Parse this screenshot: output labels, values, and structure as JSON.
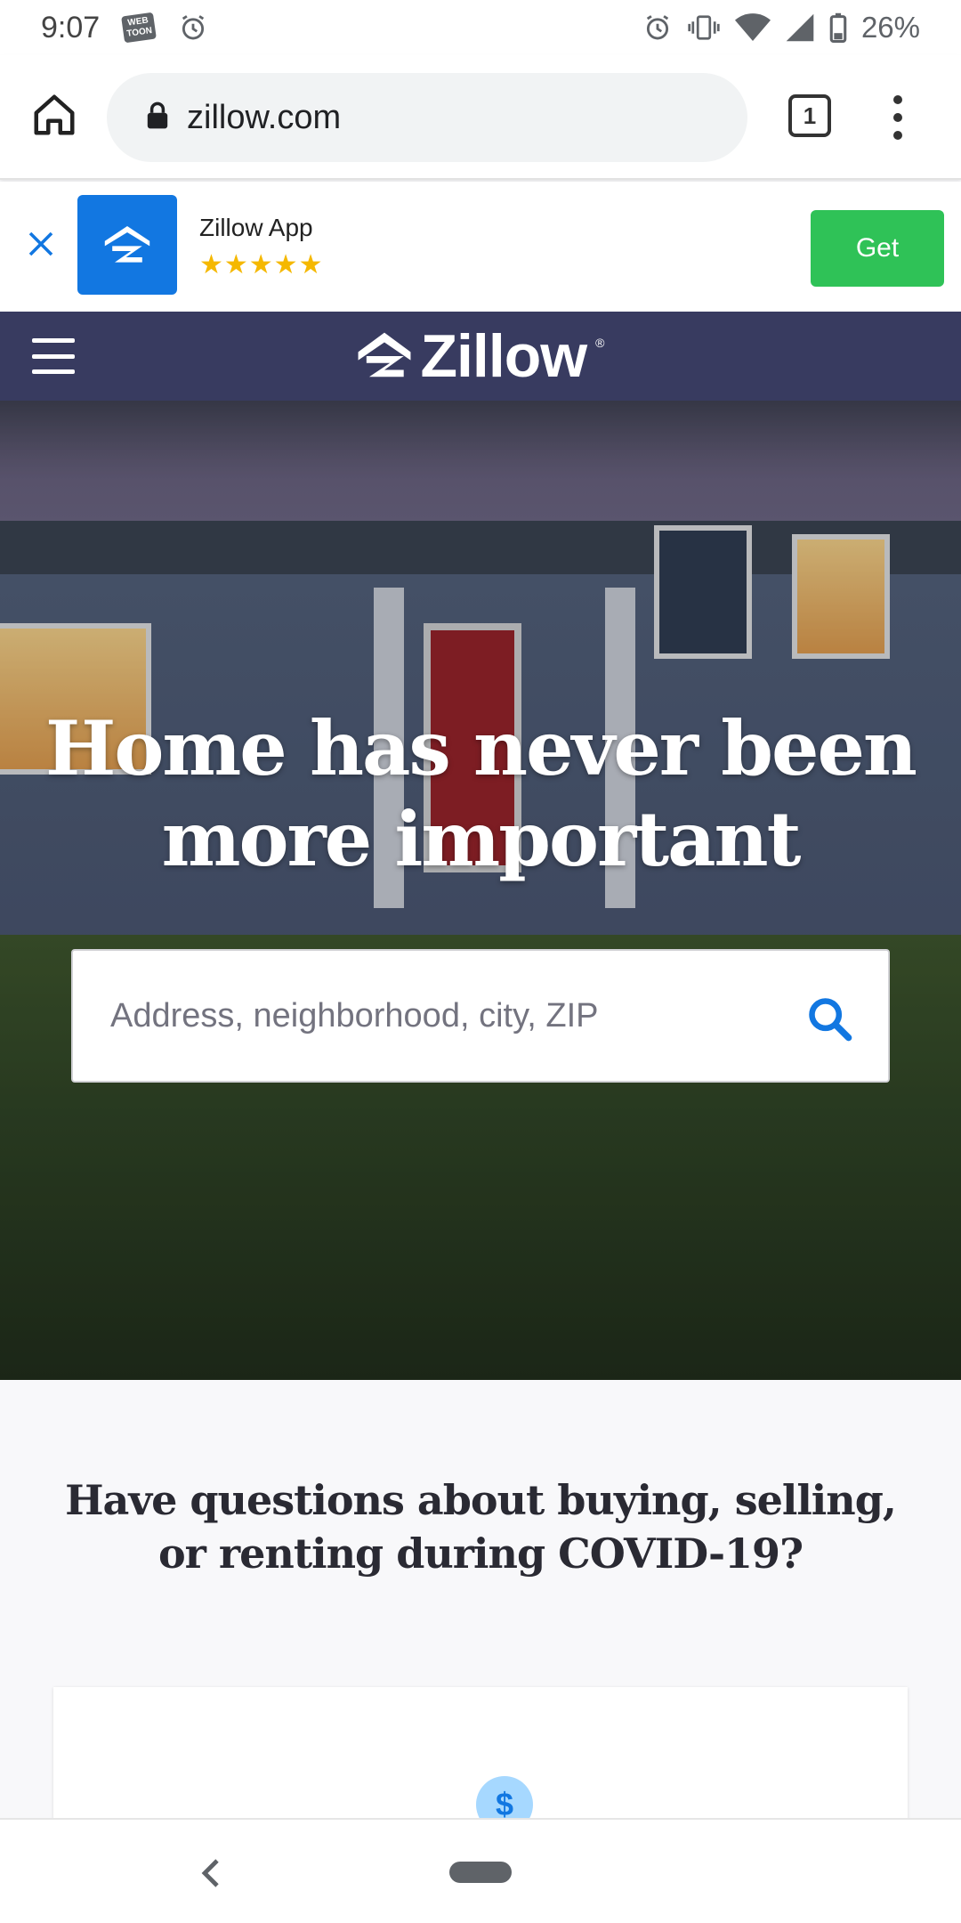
{
  "status_bar": {
    "time": "9:07",
    "webtoon_label": "WEB TOON",
    "battery": "26%",
    "icons": [
      "alarm-icon",
      "vibrate-icon",
      "wifi-icon",
      "signal-icon",
      "battery-icon"
    ]
  },
  "browser": {
    "url": "zillow.com",
    "tab_count": "1",
    "icons": [
      "home-icon",
      "lock-icon",
      "tabs-icon",
      "more-vert-icon"
    ]
  },
  "app_banner": {
    "app_name": "Zillow App",
    "stars": "★★★★★",
    "rating": 5,
    "get_label": "Get",
    "colors": {
      "get_button": "#2fc257",
      "app_icon_bg": "#1277e1",
      "star": "#f5b800"
    }
  },
  "header": {
    "logo_text": "Zillow",
    "logo_mark": "®",
    "bg_color": "#383b60"
  },
  "hero": {
    "title": "Home has never been more important",
    "search": {
      "placeholder": "Address, neighborhood, city, ZIP",
      "value": ""
    },
    "accent_color": "#1277e1"
  },
  "covid": {
    "heading": "Have questions about buying, selling, or renting during COVID-19?",
    "card_icon_label": "$"
  },
  "nav_bar": {
    "icons": [
      "back-icon",
      "home-pill-icon"
    ]
  }
}
